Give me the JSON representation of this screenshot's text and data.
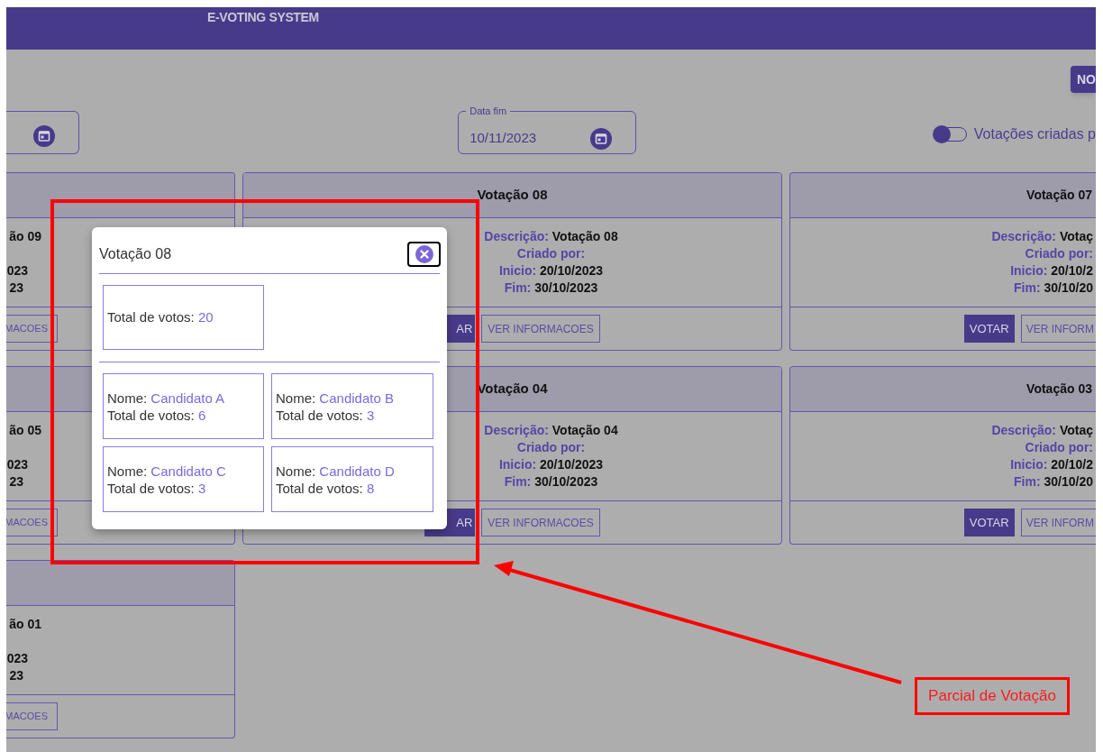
{
  "header": {
    "title": "E-VOTING SYSTEM"
  },
  "toolbar": {
    "new_button": "NO"
  },
  "filters": {
    "end_date": {
      "label": "Data fim",
      "value": "10/11/2023"
    },
    "toggle": {
      "label": "Votações criadas p",
      "on": false
    }
  },
  "cards": [
    {
      "kind": "cut_left",
      "lines": [
        "ão 09",
        "023",
        "23"
      ],
      "buttons": [
        "MACOES"
      ]
    },
    {
      "kind": "full",
      "title": "Votação 08",
      "fields": [
        {
          "label": "Descrição:",
          "value": "Votação 08"
        },
        {
          "label": "Criado por:"
        },
        {
          "label": "Inicio:",
          "value": "20/10/2023"
        },
        {
          "label": "Fim:",
          "value": "30/10/2023"
        }
      ],
      "buttons": [
        "AR",
        "VER INFORMACOES"
      ]
    },
    {
      "kind": "cut_right",
      "title": "Votação 07",
      "fields": [
        {
          "label": "Descrição:",
          "value": "Votaç"
        },
        {
          "label": "Criado por:"
        },
        {
          "label": "Inicio:",
          "value": "20/10/2"
        },
        {
          "label": "Fim:",
          "value": "30/10/20"
        }
      ],
      "buttons": [
        "VOTAR",
        "VER INFORM"
      ]
    },
    {
      "kind": "cut_left",
      "lines": [
        "ão 05",
        "023",
        "23"
      ],
      "buttons": [
        "MACOES"
      ]
    },
    {
      "kind": "full",
      "title": "Votação 04",
      "fields": [
        {
          "label": "Descrição:",
          "value": "Votação 04"
        },
        {
          "label": "Criado por:"
        },
        {
          "label": "Inicio:",
          "value": "20/10/2023"
        },
        {
          "label": "Fim:",
          "value": "30/10/2023"
        }
      ],
      "buttons": [
        "AR",
        "VER INFORMACOES"
      ]
    },
    {
      "kind": "cut_right",
      "title": "Votação 03",
      "fields": [
        {
          "label": "Descrição:",
          "value": "Votaç"
        },
        {
          "label": "Criado por:"
        },
        {
          "label": "Inicio:",
          "value": "20/10/2"
        },
        {
          "label": "Fim:",
          "value": "30/10/20"
        }
      ],
      "buttons": [
        "VOTAR",
        "VER INFORM"
      ]
    },
    {
      "kind": "cut_left",
      "lines": [
        "ão 01",
        "023",
        "23"
      ],
      "buttons": [
        "MACOES"
      ]
    }
  ],
  "modal": {
    "title": "Votação 08",
    "total": {
      "label": "Total de votos:",
      "value": "20"
    },
    "candidates": [
      {
        "name_label": "Nome:",
        "name": "Candidato A",
        "votes_label": "Total de votos:",
        "votes": "6"
      },
      {
        "name_label": "Nome:",
        "name": "Candidato B",
        "votes_label": "Total de votos:",
        "votes": "3"
      },
      {
        "name_label": "Nome:",
        "name": "Candidato C",
        "votes_label": "Total de votos:",
        "votes": "3"
      },
      {
        "name_label": "Nome:",
        "name": "Candidato D",
        "votes_label": "Total de votos:",
        "votes": "8"
      }
    ]
  },
  "annotation": {
    "label": "Parcial de Votação"
  }
}
